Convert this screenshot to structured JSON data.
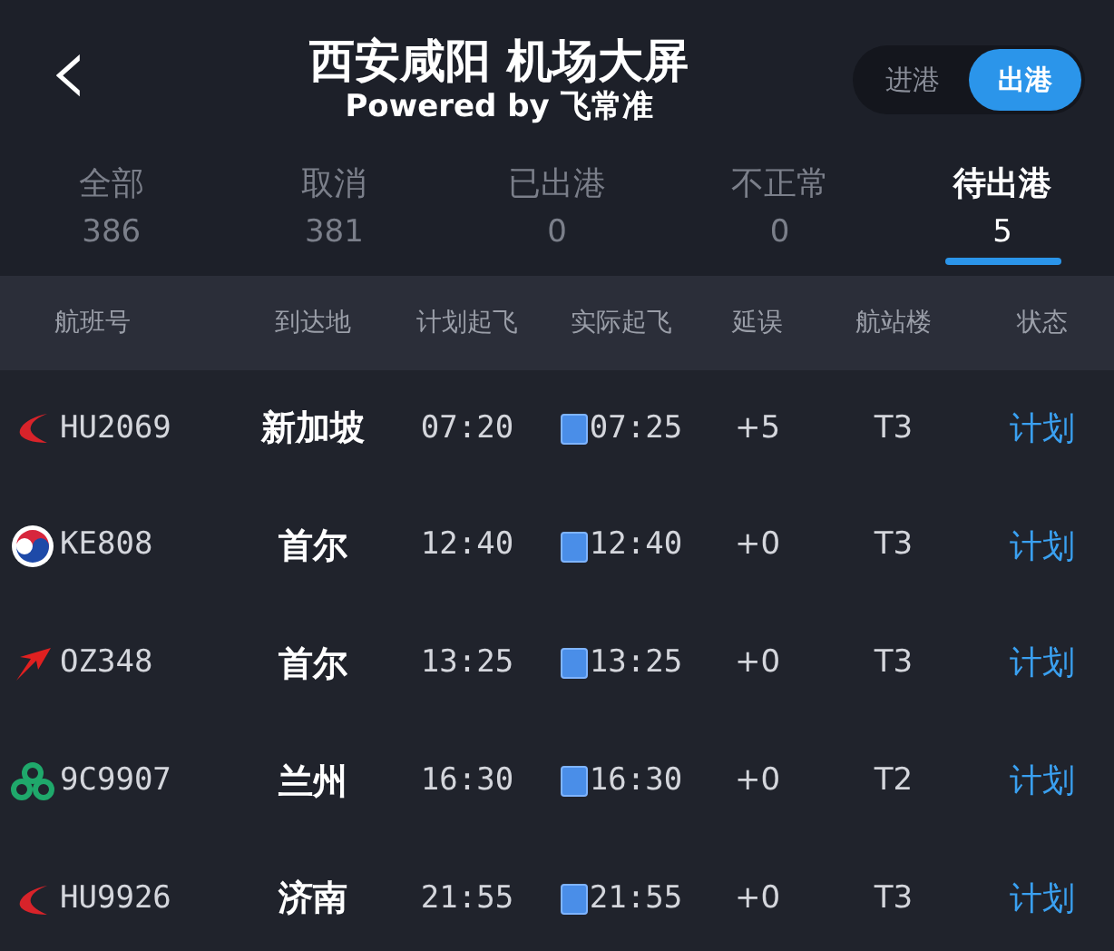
{
  "header": {
    "back": "‹",
    "title": "西安咸阳 机场大屏",
    "subtitle": "Powered by 飞常准"
  },
  "toggle": [
    {
      "label": "进港",
      "selected": false
    },
    {
      "label": "出港",
      "selected": true
    }
  ],
  "tabs": [
    {
      "label": "全部",
      "count": "386",
      "selected": false
    },
    {
      "label": "取消",
      "count": "381",
      "selected": false
    },
    {
      "label": "已出港",
      "count": "0",
      "selected": false
    },
    {
      "label": "不正常",
      "count": "0",
      "selected": false
    },
    {
      "label": "待出港",
      "count": "5",
      "selected": true
    }
  ],
  "table": {
    "columns": [
      "航班号",
      "到达地",
      "计划起飞",
      "实际起飞",
      "延误",
      "航站楼",
      "状态"
    ],
    "rows": [
      {
        "kind": "swoosh",
        "flight": "HU2069",
        "destination": "新加坡",
        "scheduled": "07:20",
        "actual": "07:25",
        "delay": "+5",
        "terminal": "T3",
        "status": "计划"
      },
      {
        "kind": "taegeuk",
        "flight": "KE808",
        "destination": "首尔",
        "scheduled": "12:40",
        "actual": "12:40",
        "delay": "+0",
        "terminal": "T3",
        "status": "计划"
      },
      {
        "kind": "arrow",
        "flight": "OZ348",
        "destination": "首尔",
        "scheduled": "13:25",
        "actual": "13:25",
        "delay": "+0",
        "terminal": "T3",
        "status": "计划"
      },
      {
        "kind": "trefoil",
        "flight": "9C9907",
        "destination": "兰州",
        "scheduled": "16:30",
        "actual": "16:30",
        "delay": "+0",
        "terminal": "T2",
        "status": "计划"
      },
      {
        "kind": "swoosh",
        "flight": "HU9926",
        "destination": "济南",
        "scheduled": "21:55",
        "actual": "21:55",
        "delay": "+0",
        "terminal": "T3",
        "status": "计划"
      }
    ]
  }
}
